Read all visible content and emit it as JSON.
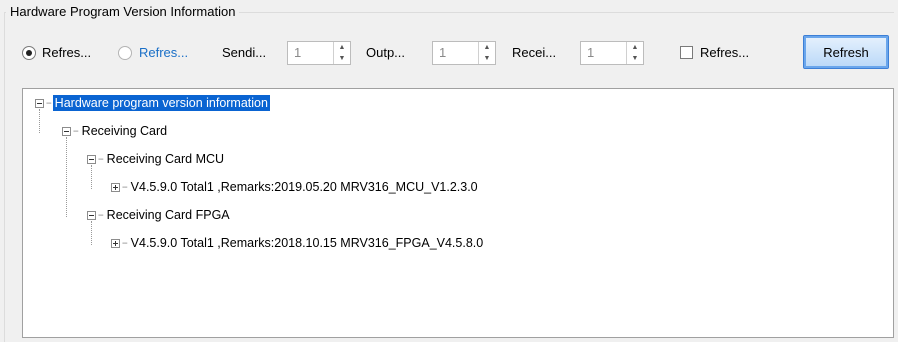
{
  "group_title": "Hardware Program Version Information",
  "toolbar": {
    "radio1_label": "Refres...",
    "radio2_label": "Refres...",
    "sending_label": "Sendi...",
    "sending_value": "1",
    "output_label": "Outp...",
    "output_value": "1",
    "receiving_label": "Recei...",
    "receiving_value": "1",
    "checkbox_label": "Refres...",
    "refresh_button": "Refresh"
  },
  "tree": {
    "root": "Hardware program version information",
    "receiving_card": "Receiving Card",
    "mcu": "Receiving Card MCU",
    "mcu_version": "V4.5.9.0 Total1 ,Remarks:2019.05.20 MRV316_MCU_V1.2.3.0",
    "fpga": "Receiving Card FPGA",
    "fpga_version": "V4.5.9.0 Total1 ,Remarks:2018.10.15 MRV316_FPGA_V4.5.8.0"
  }
}
